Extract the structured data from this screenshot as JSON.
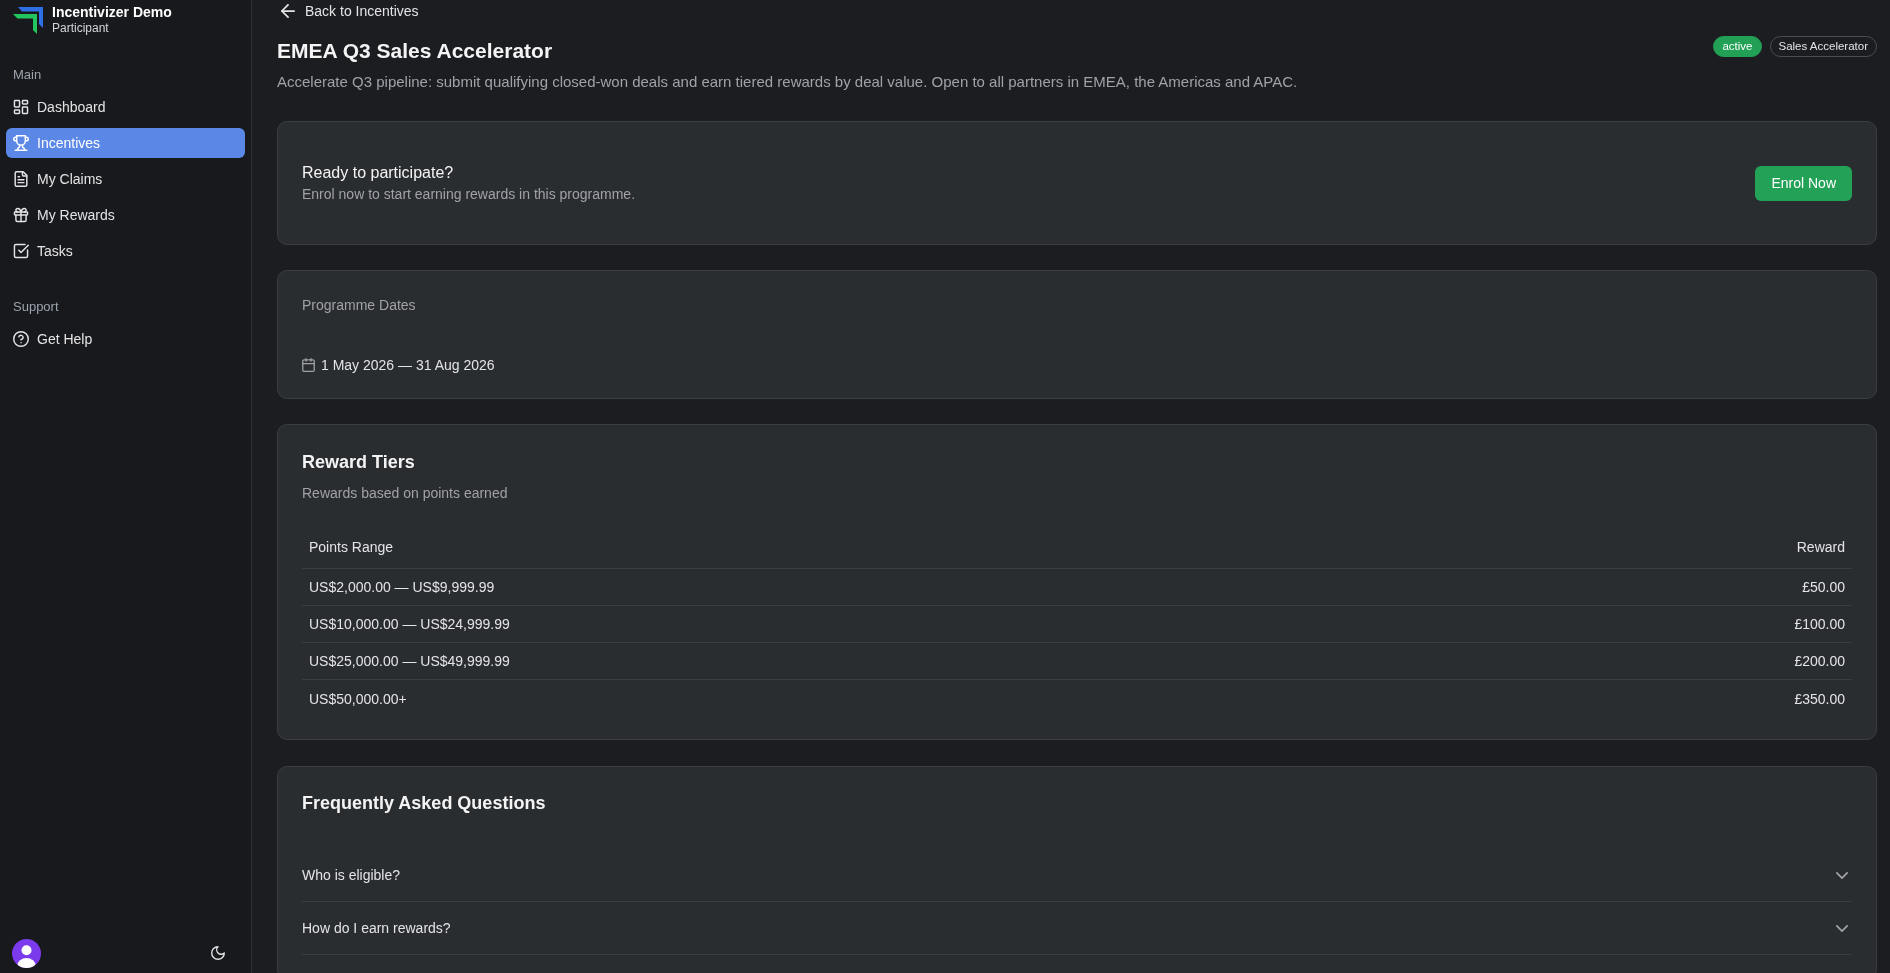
{
  "sidebar": {
    "brand": {
      "title": "Incentivizer Demo",
      "subtitle": "Participant"
    },
    "sections": [
      {
        "label": "Main",
        "items": [
          {
            "label": "Dashboard",
            "selected": false
          },
          {
            "label": "Incentives",
            "selected": true
          },
          {
            "label": "My Claims",
            "selected": false
          },
          {
            "label": "My Rewards",
            "selected": false
          },
          {
            "label": "Tasks",
            "selected": false
          }
        ]
      },
      {
        "label": "Support",
        "items": [
          {
            "label": "Get Help",
            "selected": false
          }
        ]
      }
    ]
  },
  "back_link": "Back to Incentives",
  "header": {
    "title": "EMEA Q3 Sales Accelerator",
    "description": "Accelerate Q3 pipeline: submit qualifying closed-won deals and earn tiered rewards by deal value. Open to all partners in EMEA, the Americas and APAC.",
    "badges": [
      {
        "label": "active",
        "kind": "status"
      },
      {
        "label": "Sales Accelerator",
        "kind": "category"
      }
    ]
  },
  "enrol_card": {
    "title": "Ready to participate?",
    "text": "Enrol now to start earning rewards in this programme.",
    "button": "Enrol Now"
  },
  "dates_card": {
    "label": "Programme Dates",
    "range": "1 May 2026 — 31 Aug 2026"
  },
  "reward_tiers": {
    "title": "Reward Tiers",
    "subtitle": "Rewards based on points earned",
    "columns": [
      "Points Range",
      "Reward"
    ],
    "rows": [
      [
        "US$2,000.00 — US$9,999.99",
        "£50.00"
      ],
      [
        "US$10,000.00 — US$24,999.99",
        "£100.00"
      ],
      [
        "US$25,000.00 — US$49,999.99",
        "£200.00"
      ],
      [
        "US$50,000.00+",
        "£350.00"
      ]
    ]
  },
  "faq": {
    "title": "Frequently Asked Questions",
    "items": [
      {
        "question": "Who is eligible?",
        "expanded": false
      },
      {
        "question": "How do I earn rewards?",
        "expanded": false
      }
    ]
  }
}
